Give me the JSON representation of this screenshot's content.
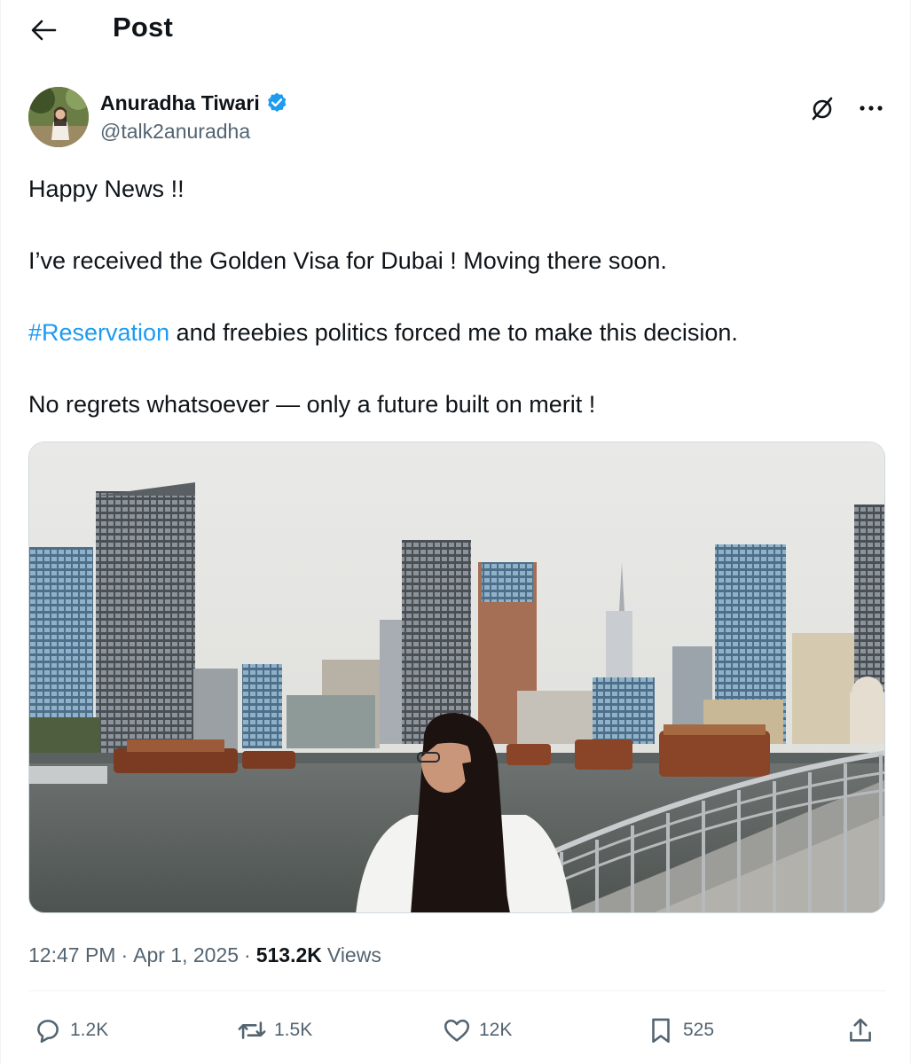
{
  "header": {
    "back_icon": "arrow-left-icon",
    "title": "Post"
  },
  "author": {
    "name": "Anuradha Tiwari",
    "handle": "@talk2anuradha",
    "verified": true,
    "verified_color": "#1d9bf0"
  },
  "top_actions": {
    "grok_icon": "grok-icon",
    "more_icon": "more-horizontal-icon"
  },
  "tweet": {
    "line1": "Happy News !!",
    "line2": "I’ve received the Golden Visa for Dubai ! Moving there soon.",
    "line3_hashtag": "#Reservation",
    "line3_rest": " and freebies politics forced me to make this decision.",
    "line4": "No regrets whatsoever — only a future built on merit !"
  },
  "meta": {
    "time": "12:47 PM",
    "separator": "·",
    "date": "Apr 1, 2025",
    "views_count": "513.2K",
    "views_label": "Views"
  },
  "actions": {
    "replies": "1.2K",
    "reposts": "1.5K",
    "likes": "12K",
    "bookmarks": "525"
  },
  "colors": {
    "text": "#0f1419",
    "secondary": "#536471",
    "accent": "#1d9bf0",
    "divider": "#eff3f4"
  }
}
